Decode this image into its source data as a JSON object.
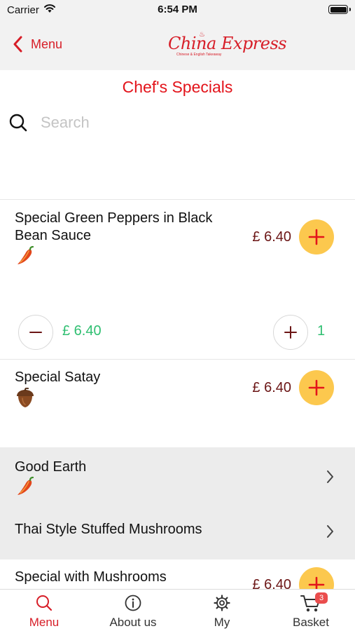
{
  "status_bar": {
    "carrier": "Carrier",
    "time": "6:54 PM"
  },
  "nav": {
    "back_label": "Menu",
    "logo_text": "China Express",
    "logo_tagline": "Chinese & English Takeaway"
  },
  "page_title": "Chef's Specials",
  "search": {
    "placeholder": "Search",
    "value": ""
  },
  "items": [
    {
      "name": "Special Green Peppers in Black Bean Sauce",
      "price": "£ 6.40",
      "icon": "chili-pepper-icon"
    },
    {
      "name": "Special Satay",
      "price": "£ 6.40",
      "icon": "acorn-icon"
    },
    {
      "name": "Special with Mushrooms",
      "price": "£ 6.40"
    }
  ],
  "basket_line": {
    "total": "£ 6.40",
    "quantity": "1"
  },
  "categories": [
    {
      "label": "Good Earth",
      "icon": "chili-pepper-icon"
    },
    {
      "label": "Thai Style Stuffed Mushrooms"
    }
  ],
  "tabs": [
    {
      "label": "Menu",
      "icon": "search-icon",
      "active": true
    },
    {
      "label": "About us",
      "icon": "info-icon"
    },
    {
      "label": "My",
      "icon": "gear-icon"
    },
    {
      "label": "Basket",
      "icon": "cart-icon",
      "badge": "3"
    }
  ],
  "colors": {
    "accent": "#d71e28",
    "price": "#6b1515",
    "add_button": "#fcc84e",
    "quantity": "#2fbf71",
    "badge": "#ea4d4d"
  }
}
